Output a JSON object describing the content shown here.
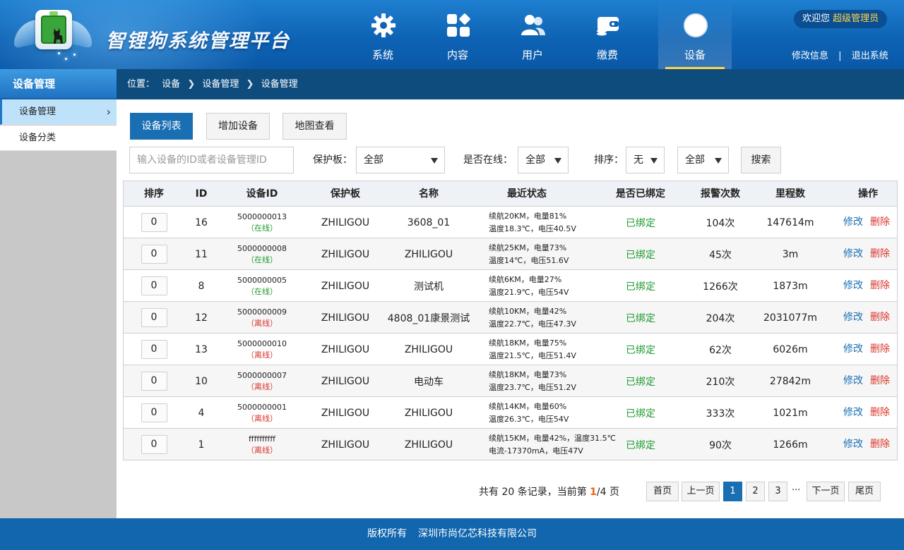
{
  "header": {
    "title": "智锂狗系统管理平台",
    "welcome_prefix": "欢迎您",
    "role": "超级管理员",
    "link_edit_info": "修改信息",
    "link_separator": "|",
    "link_logout": "退出系统"
  },
  "nav": {
    "items": [
      {
        "label": "系统",
        "icon": "gear-icon"
      },
      {
        "label": "内容",
        "icon": "grid-icon"
      },
      {
        "label": "用户",
        "icon": "users-icon"
      },
      {
        "label": "缴费",
        "icon": "wallet-icon"
      },
      {
        "label": "设备",
        "icon": "device-icon",
        "active": true
      }
    ]
  },
  "sidebar": {
    "header": "设备管理",
    "items": [
      {
        "label": "设备管理",
        "active": true
      },
      {
        "label": "设备分类"
      }
    ]
  },
  "breadcrumb": {
    "label": "位置：",
    "items": [
      "设备",
      "设备管理",
      "设备管理"
    ]
  },
  "actions": {
    "list_button": "设备列表",
    "add_button": "增加设备",
    "map_button": "地图查看"
  },
  "filters": {
    "search_placeholder": "输入设备的ID或者设备管理ID",
    "board_label": "保护板：",
    "board_value": "全部",
    "online_label": "是否在线：",
    "online_value": "全部",
    "sort_label": "排序：",
    "sort_value": "无",
    "extra_value": "全部",
    "search_button": "搜索"
  },
  "table": {
    "columns": [
      "排序",
      "ID",
      "设备ID",
      "保护板",
      "名称",
      "最近状态",
      "是否已绑定",
      "报警次数",
      "里程数",
      "操作"
    ],
    "edit_label": "修改",
    "delete_label": "删除",
    "rows": [
      {
        "sort": "0",
        "id": "16",
        "device_id": "5000000013",
        "online": "（在线）",
        "online_status": "on",
        "board": "ZHILIGOU",
        "name": "3608_01",
        "status_line1": "续航20KM，电量81%",
        "status_line2": "温度18.3℃，电压40.5V",
        "bound": "已绑定",
        "alarms": "104次",
        "mileage": "147614m"
      },
      {
        "sort": "0",
        "id": "11",
        "device_id": "5000000008",
        "online": "（在线）",
        "online_status": "on",
        "board": "ZHILIGOU",
        "name": "ZHILIGOU",
        "status_line1": "续航25KM，电量73%",
        "status_line2": "温度14℃，电压51.6V",
        "bound": "已绑定",
        "alarms": "45次",
        "mileage": "3m"
      },
      {
        "sort": "0",
        "id": "8",
        "device_id": "5000000005",
        "online": "（在线）",
        "online_status": "on",
        "board": "ZHILIGOU",
        "name": "测试机",
        "status_line1": "续航6KM，电量27%",
        "status_line2": "温度21.9℃，电压54V",
        "bound": "已绑定",
        "alarms": "1266次",
        "mileage": "1873m"
      },
      {
        "sort": "0",
        "id": "12",
        "device_id": "5000000009",
        "online": "（离线）",
        "online_status": "off",
        "board": "ZHILIGOU",
        "name": "4808_01康景测试",
        "status_line1": "续航10KM，电量42%",
        "status_line2": "温度22.7℃，电压47.3V",
        "bound": "已绑定",
        "alarms": "204次",
        "mileage": "2031077m"
      },
      {
        "sort": "0",
        "id": "13",
        "device_id": "5000000010",
        "online": "（离线）",
        "online_status": "off",
        "board": "ZHILIGOU",
        "name": "ZHILIGOU",
        "status_line1": "续航18KM，电量75%",
        "status_line2": "温度21.5℃，电压51.4V",
        "bound": "已绑定",
        "alarms": "62次",
        "mileage": "6026m"
      },
      {
        "sort": "0",
        "id": "10",
        "device_id": "5000000007",
        "online": "（离线）",
        "online_status": "off",
        "board": "ZHILIGOU",
        "name": "电动车",
        "status_line1": "续航18KM，电量73%",
        "status_line2": "温度23.7℃，电压51.2V",
        "bound": "已绑定",
        "alarms": "210次",
        "mileage": "27842m"
      },
      {
        "sort": "0",
        "id": "4",
        "device_id": "5000000001",
        "online": "（离线）",
        "online_status": "off",
        "board": "ZHILIGOU",
        "name": "ZHILIGOU",
        "status_line1": "续航14KM，电量60%",
        "status_line2": "温度26.3℃，电压54V",
        "bound": "已绑定",
        "alarms": "333次",
        "mileage": "1021m"
      },
      {
        "sort": "0",
        "id": "1",
        "device_id": "ffffffffff",
        "online": "（离线）",
        "online_status": "off",
        "board": "ZHILIGOU",
        "name": "ZHILIGOU",
        "status_line1": "续航15KM，电量42%，温度31.5℃",
        "status_line2": "电流-17370mA，电压47V",
        "bound": "已绑定",
        "alarms": "90次",
        "mileage": "1266m"
      }
    ]
  },
  "pagination": {
    "info_prefix": "共有 20 条记录，当前第 ",
    "current": "1",
    "info_suffix": "/4 页",
    "first": "首页",
    "prev": "上一页",
    "pages": [
      "1",
      "2",
      "3"
    ],
    "dots": "···",
    "next": "下一页",
    "last": "尾页"
  },
  "footer": {
    "label": "版权所有",
    "company": "深圳市尚亿芯科技有限公司"
  },
  "colors": {
    "header_blue": "#0e63b4",
    "breadcrumb_bg": "#0e4c7d",
    "primary": "#1a6fb3",
    "online_green": "#1f9b2f",
    "offline_red": "#d9342b",
    "role_yellow": "#ffd54a"
  }
}
